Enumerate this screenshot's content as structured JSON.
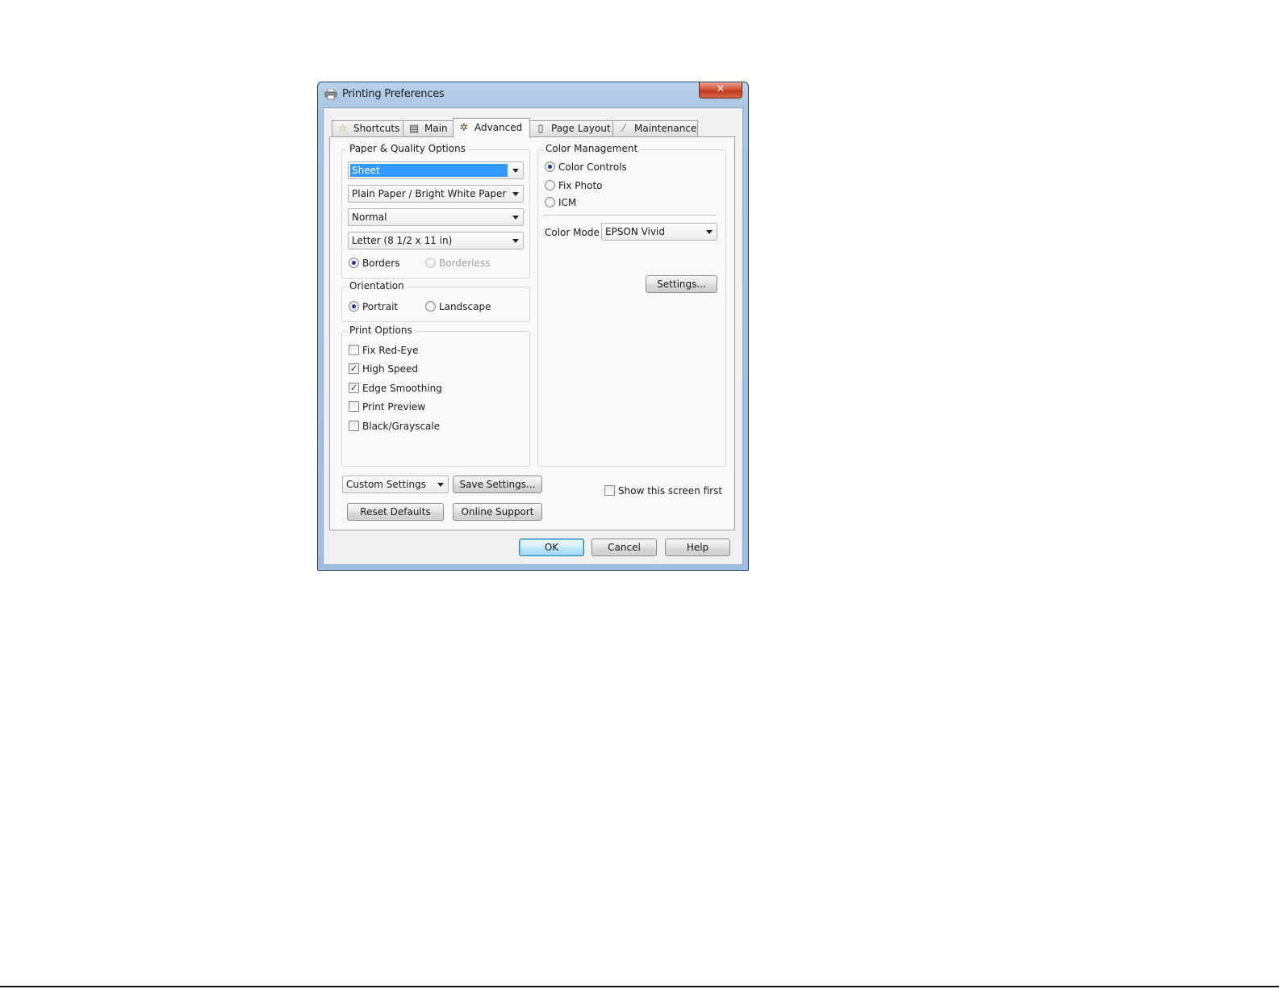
{
  "window": {
    "title": "Printing Preferences",
    "close_glyph": "✕"
  },
  "tabs": [
    {
      "label": "Shortcuts",
      "icon": "star-icon",
      "glyph": "☆"
    },
    {
      "label": "Main",
      "icon": "printer-icon",
      "glyph": "▤"
    },
    {
      "label": "Advanced",
      "icon": "gears-icon",
      "glyph": "✲"
    },
    {
      "label": "Page Layout",
      "icon": "page-icon",
      "glyph": "▯"
    },
    {
      "label": "Maintenance",
      "icon": "wrench-icon",
      "glyph": "⁄"
    }
  ],
  "active_tab": "Advanced",
  "paper_quality": {
    "label": "Paper & Quality Options",
    "source": "Sheet",
    "paper_type": "Plain Paper / Bright White Paper",
    "quality": "Normal",
    "size": "Letter (8 1/2 x 11 in)",
    "borders_label": "Borders",
    "borderless_label": "Borderless",
    "borders_selected": true
  },
  "orientation": {
    "label": "Orientation",
    "portrait_label": "Portrait",
    "landscape_label": "Landscape",
    "selected": "Portrait"
  },
  "print_options": {
    "label": "Print Options",
    "items": [
      {
        "label": "Fix Red-Eye",
        "checked": false,
        "mark": ""
      },
      {
        "label": "High Speed",
        "checked": true,
        "mark": "✓"
      },
      {
        "label": "Edge Smoothing",
        "checked": true,
        "mark": "✓"
      },
      {
        "label": "Print Preview",
        "checked": false,
        "mark": ""
      },
      {
        "label": "Black/Grayscale",
        "checked": false,
        "mark": ""
      }
    ]
  },
  "color_management": {
    "label": "Color Management",
    "options": [
      "Color Controls",
      "Fix Photo",
      "ICM"
    ],
    "selected": "Color Controls",
    "color_mode_label": "Color Mode",
    "color_mode_value": "EPSON Vivid",
    "settings_button": "Settings..."
  },
  "bottom": {
    "custom_settings": "Custom Settings",
    "save_settings": "Save Settings...",
    "reset_defaults": "Reset Defaults",
    "online_support": "Online Support",
    "show_first_label": "Show this screen first",
    "show_first_checked": false
  },
  "footer": {
    "ok": "OK",
    "cancel": "Cancel",
    "help": "Help"
  },
  "colors": {
    "title_bar": "#b9d1ea",
    "close_button": "#c8462a",
    "selection": "#3399ff",
    "default_button_border": "#3c7fb1"
  }
}
